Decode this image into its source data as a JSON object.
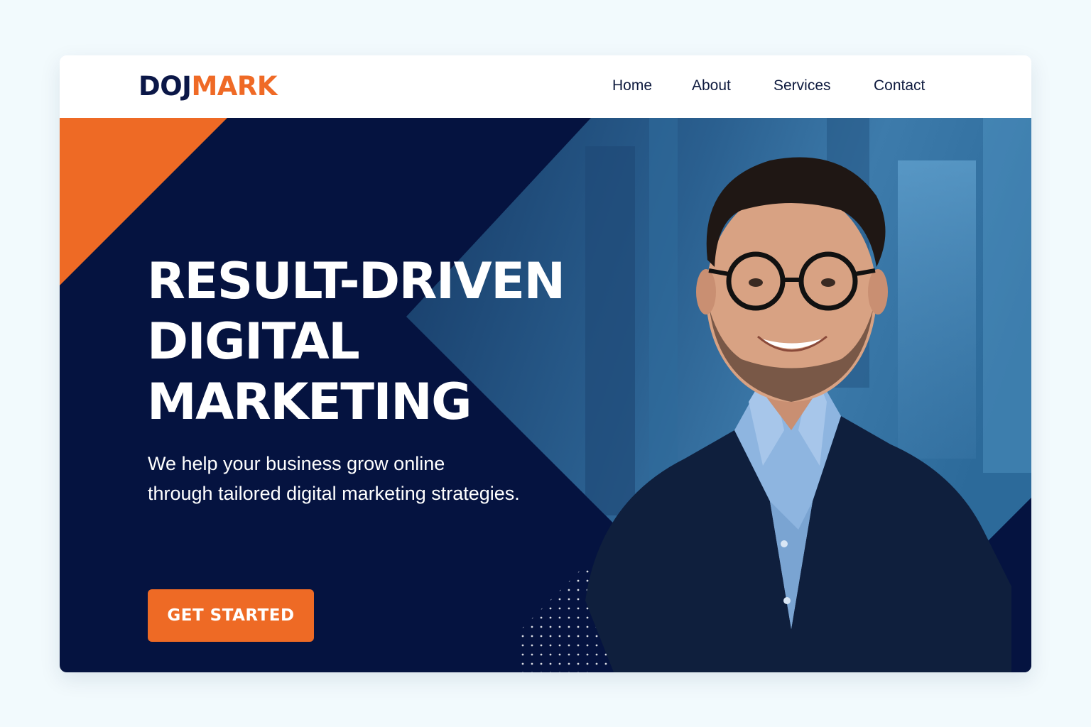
{
  "brand": {
    "part1": "DOJ",
    "part2": "MARK",
    "color_primary": "#0b1747",
    "color_accent": "#ef6a26"
  },
  "nav": {
    "items": [
      {
        "label": "Home"
      },
      {
        "label": "About"
      },
      {
        "label": "Services"
      },
      {
        "label": "Contact"
      }
    ]
  },
  "hero": {
    "headline": [
      "RESULT-DRIVEN",
      "DIGITAL",
      "MARKETING"
    ],
    "subtitle": [
      "We help your business grow online",
      "through tailored digital marketing strategies."
    ],
    "cta_label": "GET STARTED",
    "background_color": "#051340",
    "accent_color": "#ee6a25",
    "image": "smiling-businessman-with-glasses-photo"
  }
}
